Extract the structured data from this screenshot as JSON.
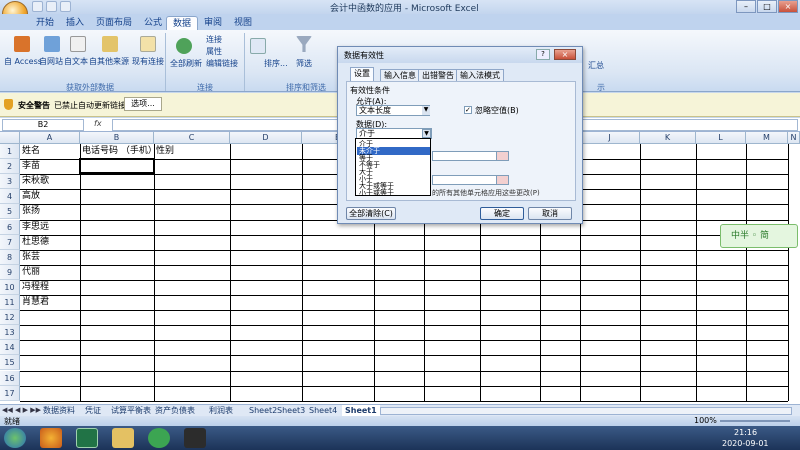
{
  "window": {
    "title": "会计中函数的应用 - Microsoft Excel"
  },
  "tabs": [
    "开始",
    "插入",
    "页面布局",
    "公式",
    "数据",
    "审阅",
    "视图"
  ],
  "active_tab": "数据",
  "ribbon": {
    "get_external": {
      "items": [
        "自 Access",
        "自网站",
        "自文本",
        "自其他来源",
        "现有连接"
      ],
      "label": "获取外部数据"
    },
    "connections": {
      "refresh": "全部刷新",
      "items": [
        "连接",
        "属性",
        "编辑链接"
      ],
      "label": "连接"
    },
    "sort": {
      "items": [
        "排序...",
        "筛选"
      ],
      "label": "排序和筛选"
    },
    "right_items": [
      "汇总"
    ],
    "right_label": "示"
  },
  "security": {
    "title": "安全警告",
    "message": "已禁止自动更新链接",
    "options_button": "选项..."
  },
  "formula_bar": {
    "name_box": "B2",
    "fx": "fx"
  },
  "columns": [
    "A",
    "B",
    "C",
    "D",
    "E",
    "F",
    "G",
    "H",
    "I",
    "J",
    "K",
    "L",
    "M",
    "N"
  ],
  "rows": [
    "1",
    "2",
    "3",
    "4",
    "5",
    "6",
    "7",
    "8",
    "9",
    "10",
    "11",
    "12",
    "13",
    "14",
    "15",
    "16",
    "17"
  ],
  "cells": {
    "a1": "姓名",
    "b1": "电话号码 （手机）",
    "c1": "性别",
    "names": [
      "李苗",
      "宋秋歌",
      "高放",
      "张扬",
      "李思远",
      "杜思德",
      "张芸",
      "代丽",
      "冯程程",
      "肖慧君"
    ]
  },
  "sheet_tabs": [
    "数据资料",
    "凭证",
    "试算平衡表",
    "资产负债表",
    "利润表",
    "Sheet2",
    "Sheet3",
    "Sheet4",
    "Sheet1"
  ],
  "active_sheet": "Sheet1",
  "status": {
    "left": "就绪",
    "zoom": "100%"
  },
  "taskbar": {
    "time": "21:16",
    "date": "2020-09-01"
  },
  "ime": {
    "label": "中半 ◦ 简"
  },
  "dialog": {
    "title": "数据有效性",
    "tabs": [
      "设置",
      "输入信息",
      "出错警告",
      "输入法模式"
    ],
    "section": "有效性条件",
    "allow_label": "允许(A):",
    "allow_value": "文本长度",
    "ignore_blank": "忽略空值(B)",
    "data_label": "数据(D):",
    "data_value": "介于",
    "apply_text": "的所有其他单元格应用这些更改(P)",
    "clear_all": "全部清除(C)",
    "ok": "确定",
    "cancel": "取消",
    "dropdown_options": [
      "介于",
      "未介于",
      "等于",
      "不等于",
      "大于",
      "小于",
      "大于或等于",
      "小于或等于"
    ],
    "dropdown_selected": "未介于"
  }
}
